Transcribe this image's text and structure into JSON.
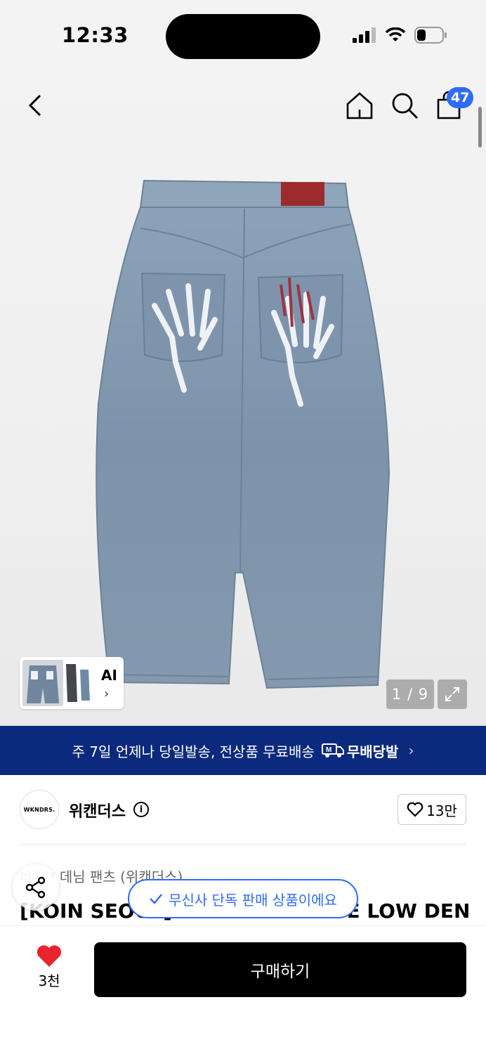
{
  "status_bar": {
    "time": "12:33"
  },
  "nav": {
    "cart_count": "47"
  },
  "gallery": {
    "thumb_label": "AI",
    "counter": "1 / 9"
  },
  "banner": {
    "text": "주 7일 언제나 당일발송, 전상품 무료배송",
    "brand": "무배당발",
    "brand_mark": "M"
  },
  "brand": {
    "logo_text": "WKNDRS.",
    "name": "위캔더스",
    "likes": "13만"
  },
  "product": {
    "breadcrumb_prefix": "바지",
    "breadcrumb_category": "데님 팬츠 (위캔더스)",
    "title": "[KOIN SEOUL] SKELETON WIDE LOW DENI"
  },
  "toast": {
    "text": "무신사 단독 판매 상품이에요"
  },
  "bottom_bar": {
    "fav_count": "3천",
    "buy_label": "구매하기"
  },
  "colors": {
    "accent": "#2f6cf6",
    "banner": "#0b2a7d",
    "heart": "#e8242e",
    "denim": "#7f98b0"
  }
}
